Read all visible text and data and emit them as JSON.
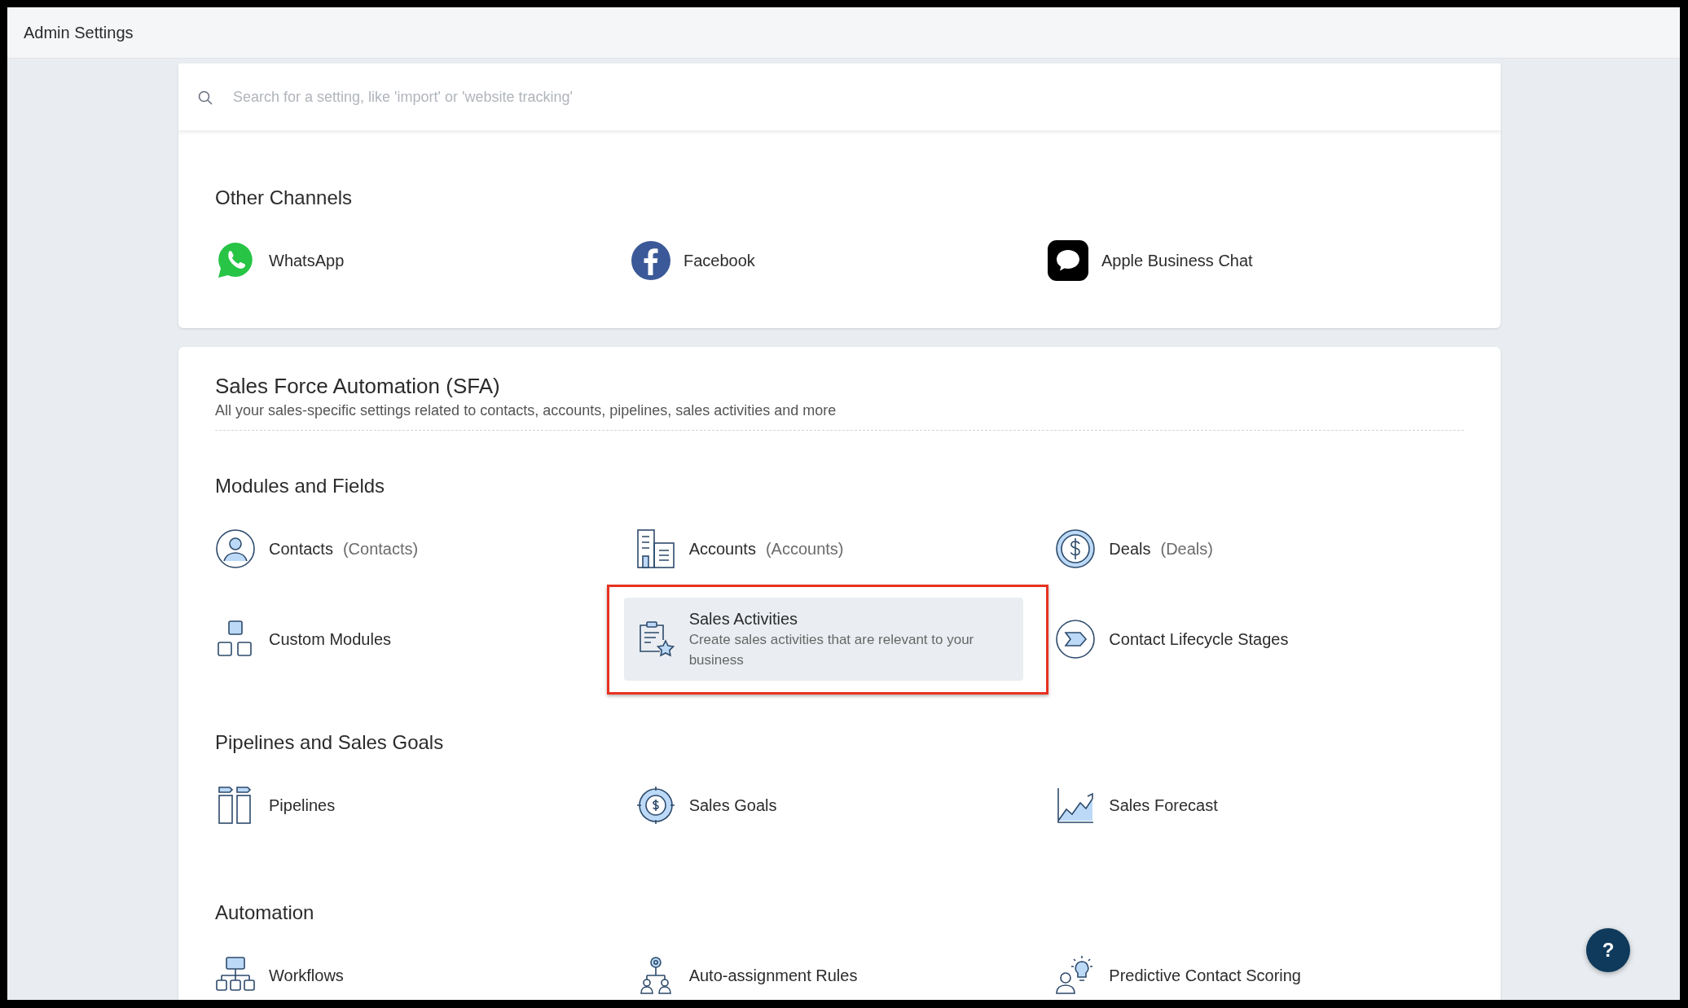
{
  "header": {
    "title": "Admin Settings"
  },
  "search": {
    "placeholder": "Search for a setting, like 'import' or 'website tracking'"
  },
  "channels": {
    "title": "Other Channels",
    "items": [
      {
        "label": "WhatsApp"
      },
      {
        "label": "Facebook"
      },
      {
        "label": "Apple Business Chat"
      }
    ]
  },
  "sfa": {
    "title": "Sales Force Automation (SFA)",
    "subtitle": "All your sales-specific settings related to contacts, accounts, pipelines, sales activities and more",
    "groups": [
      {
        "title": "Modules and Fields",
        "items": [
          {
            "label": "Contacts",
            "secondary": "(Contacts)",
            "highlighted": false
          },
          {
            "label": "Accounts",
            "secondary": "(Accounts)",
            "highlighted": false
          },
          {
            "label": "Deals",
            "secondary": "(Deals)",
            "highlighted": false
          },
          {
            "label": "Custom Modules",
            "highlighted": false
          },
          {
            "label": "Sales Activities",
            "description": "Create sales activities that are relevant to your business",
            "highlighted": true
          },
          {
            "label": "Contact Lifecycle Stages",
            "highlighted": false
          }
        ]
      },
      {
        "title": "Pipelines and Sales Goals",
        "items": [
          {
            "label": "Pipelines",
            "highlighted": false
          },
          {
            "label": "Sales Goals",
            "highlighted": false
          },
          {
            "label": "Sales Forecast",
            "highlighted": false
          }
        ]
      },
      {
        "title": "Automation",
        "items": [
          {
            "label": "Workflows",
            "highlighted": false
          },
          {
            "label": "Auto-assignment Rules",
            "highlighted": false
          },
          {
            "label": "Predictive Contact Scoring",
            "highlighted": false
          }
        ]
      }
    ]
  },
  "help_button": {
    "label": "?"
  }
}
